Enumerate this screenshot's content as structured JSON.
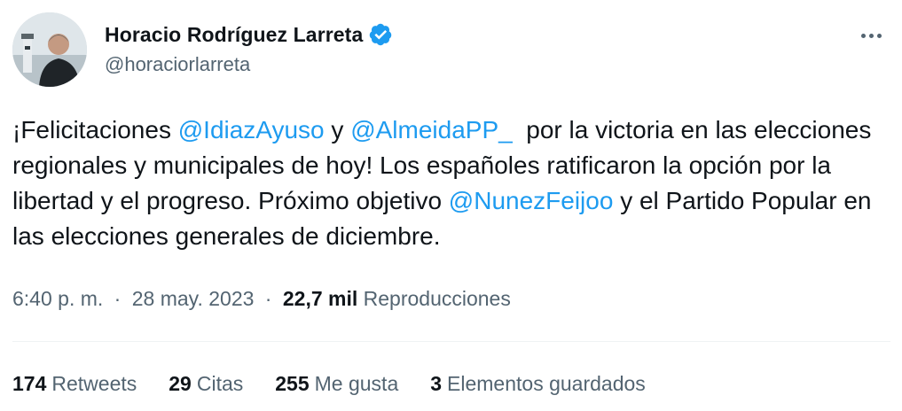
{
  "author": {
    "display_name": "Horacio Rodríguez Larreta",
    "handle": "@horaciorlarreta",
    "avatar_icon": "profile-photo",
    "verified_icon": "verified-badge-icon"
  },
  "tweet": {
    "segments": [
      {
        "type": "text",
        "value": "¡Felicitaciones "
      },
      {
        "type": "mention",
        "value": "@IdiazAyuso"
      },
      {
        "type": "text",
        "value": " y "
      },
      {
        "type": "mention",
        "value": "@AlmeidaPP_"
      },
      {
        "type": "text",
        "value": "  por la victoria en las elecciones regionales y municipales de hoy! Los españoles ratificaron la opción por la libertad y el progreso. Próximo objetivo "
      },
      {
        "type": "mention",
        "value": "@NunezFeijoo"
      },
      {
        "type": "text",
        "value": " y el Partido Popular en las elecciones generales de diciembre."
      }
    ]
  },
  "meta": {
    "time": "6:40 p. m.",
    "separator": "·",
    "date": "28 may. 2023",
    "views_count": "22,7 mil",
    "views_label": "Reproducciones"
  },
  "stats": {
    "retweets": {
      "count": "174",
      "label": "Retweets"
    },
    "quotes": {
      "count": "29",
      "label": "Citas"
    },
    "likes": {
      "count": "255",
      "label": "Me gusta"
    },
    "bookmarks": {
      "count": "3",
      "label": "Elementos guardados"
    }
  },
  "colors": {
    "accent": "#1d9bf0",
    "text": "#0f1419",
    "muted": "#536471",
    "divider": "#eff3f4"
  }
}
